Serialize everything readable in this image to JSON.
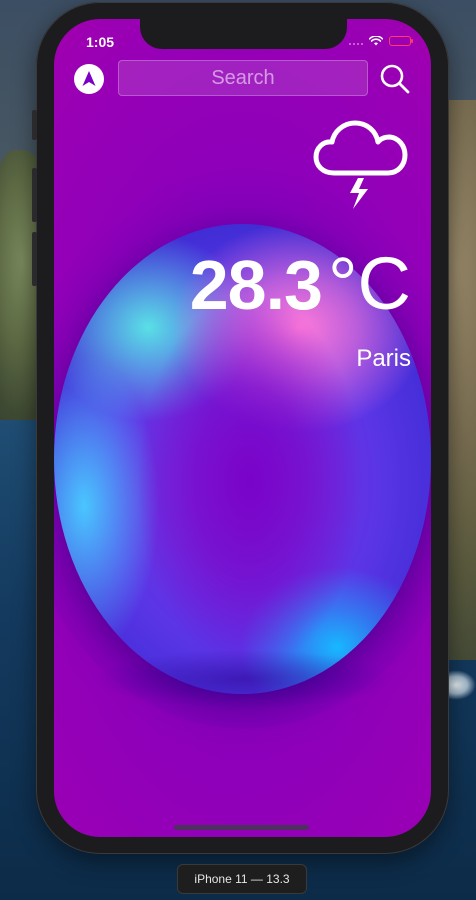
{
  "status_bar": {
    "time": "1:05"
  },
  "search": {
    "placeholder": "Search"
  },
  "weather": {
    "condition_icon": "thunderstorm-cloud-icon",
    "temperature": "28.3",
    "unit": "°C",
    "city": "Paris"
  },
  "icons": {
    "location": "location-arrow-icon",
    "search": "magnifier-icon",
    "wifi": "wifi-icon",
    "battery": "battery-icon"
  },
  "colors": {
    "background_top": "#c4008e",
    "background_main": "#7b00c4",
    "battery_low": "#ff3b6b",
    "text": "#ffffff"
  },
  "device_label": "iPhone 11 — 13.3"
}
